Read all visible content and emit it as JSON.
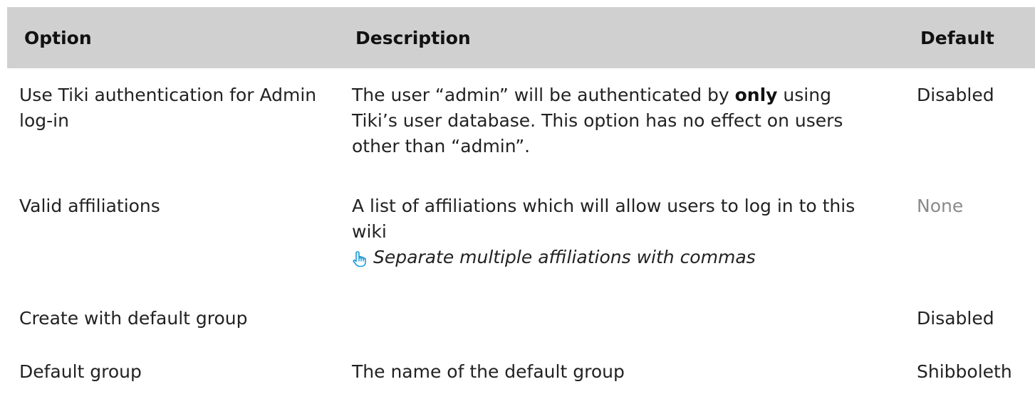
{
  "table": {
    "headers": {
      "option": "Option",
      "description": "Description",
      "default": "Default"
    },
    "rows": [
      {
        "option": "Use Tiki authentication for Admin log-in",
        "description_parts": {
          "before": "The user “admin” will be authenticated by ",
          "emphasis": "only",
          "after": " using Tiki’s user database. This option has no effect on users other than “admin”."
        },
        "default": "Disabled"
      },
      {
        "option": "Valid affiliations",
        "description": "A list of affiliations which will allow users to log in to this wiki",
        "tip": "Separate multiple affiliations with commas",
        "tip_icon": "pointing-hand-icon",
        "default": "None"
      },
      {
        "option": "Create with default group",
        "description": "",
        "default": "Disabled"
      },
      {
        "option": "Default group",
        "description": "The name of the default group",
        "default": "Shibboleth"
      }
    ]
  },
  "colors": {
    "header_bg": "#d0d0d0",
    "text": "#222222",
    "muted": "#8a8a8a",
    "tip_icon": "#1a9bd7"
  }
}
